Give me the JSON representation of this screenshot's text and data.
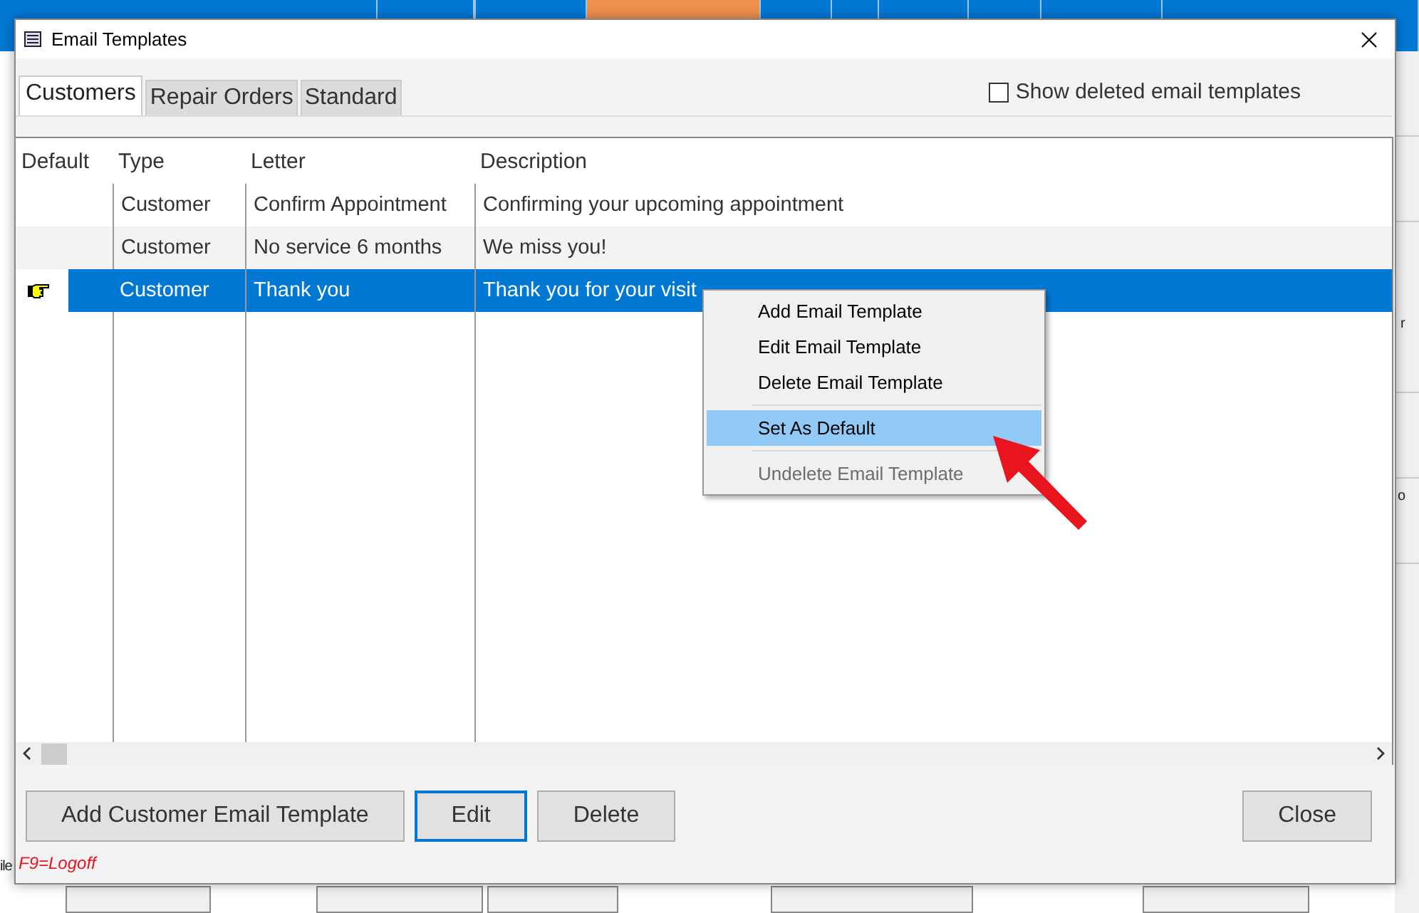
{
  "window": {
    "title": "Email Templates"
  },
  "tabs": [
    {
      "label": "Customers",
      "selected": true
    },
    {
      "label": "Repair Orders",
      "selected": false
    },
    {
      "label": "Standard",
      "selected": false
    }
  ],
  "show_deleted": {
    "label": "Show deleted email templates",
    "checked": false
  },
  "table": {
    "columns": [
      "Default",
      "Type",
      "Letter",
      "Description"
    ],
    "rows": [
      {
        "is_default": false,
        "type": "Customer",
        "letter": "Confirm Appointment",
        "description": "Confirming your upcoming appointment",
        "selected": false
      },
      {
        "is_default": false,
        "type": "Customer",
        "letter": "No service 6 months",
        "description": "We miss you!",
        "selected": false
      },
      {
        "is_default": true,
        "type": "Customer",
        "letter": "Thank you",
        "description": "Thank you for your visit",
        "selected": true
      }
    ]
  },
  "context_menu": [
    {
      "label": "Add Email Template",
      "selected": false,
      "disabled": false,
      "separator_before": false
    },
    {
      "label": "Edit Email Template",
      "selected": false,
      "disabled": false,
      "separator_before": false
    },
    {
      "label": "Delete Email Template",
      "selected": false,
      "disabled": false,
      "separator_before": false
    },
    {
      "label": "Set As Default",
      "selected": true,
      "disabled": false,
      "separator_before": true
    },
    {
      "label": "Undelete Email Template",
      "selected": false,
      "disabled": true,
      "separator_before": true
    }
  ],
  "buttons": [
    {
      "label": "Add Customer Email Template",
      "focused": false
    },
    {
      "label": "Edit",
      "focused": true
    },
    {
      "label": "Delete",
      "focused": false
    }
  ],
  "close_button": {
    "label": "Close",
    "focused": false
  },
  "hint": "F9=Logoff",
  "background_fragments": [
    "r",
    "o",
    "ile"
  ]
}
